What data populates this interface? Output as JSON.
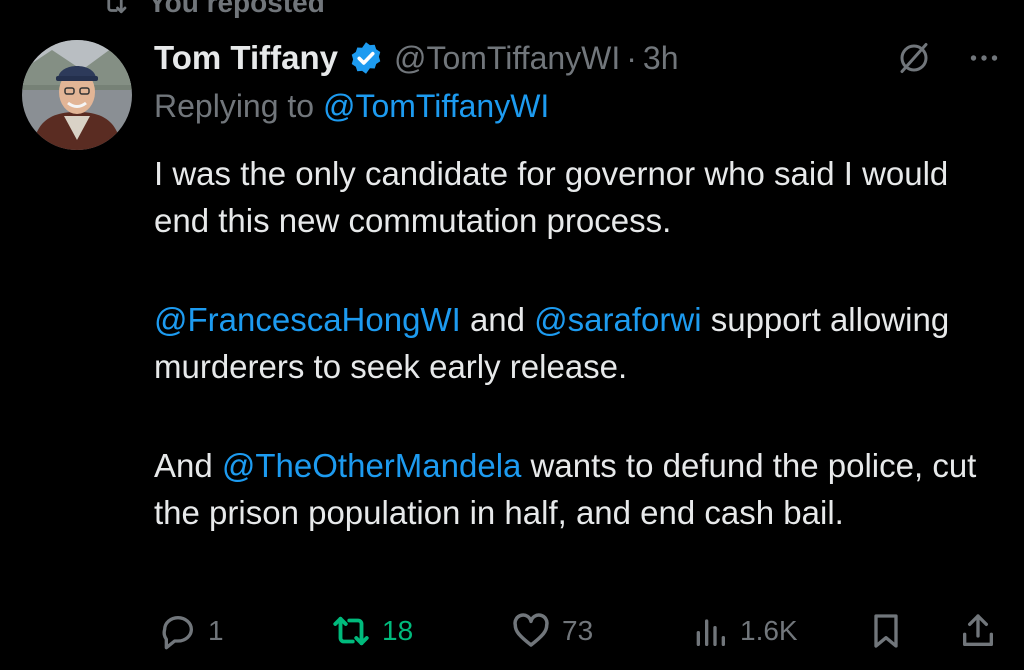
{
  "repost_banner": {
    "text": "You reposted",
    "icon": "repost-icon"
  },
  "tweet": {
    "author_name": "Tom Tiffany",
    "handle": "@TomTiffanyWI",
    "separator": "·",
    "time": "3h",
    "verified_badge_color": "#1d9bf0",
    "replying_prefix": "Replying to",
    "replying_to": "@TomTiffanyWI",
    "body": {
      "p1": "I was the only candidate for governor who said I would end this new commutation process.",
      "p2_mention1": "@FrancescaHongWI",
      "p2_and": "and",
      "p2_mention2": "@saraforwi",
      "p2_rest": "support allowing murderers to seek early release.",
      "p3_and": "And",
      "p3_mention": "@TheOtherMandela",
      "p3_rest": "wants to defund the police, cut the prison population in half, and end cash bail."
    }
  },
  "actions": {
    "reply_count": "1",
    "repost_count": "18",
    "like_count": "73",
    "views_count": "1.6K"
  },
  "colors": {
    "background": "#000000",
    "text": "#e7e9ea",
    "muted": "#71767b",
    "link": "#1d9bf0",
    "repost_active": "#00ba7c"
  }
}
